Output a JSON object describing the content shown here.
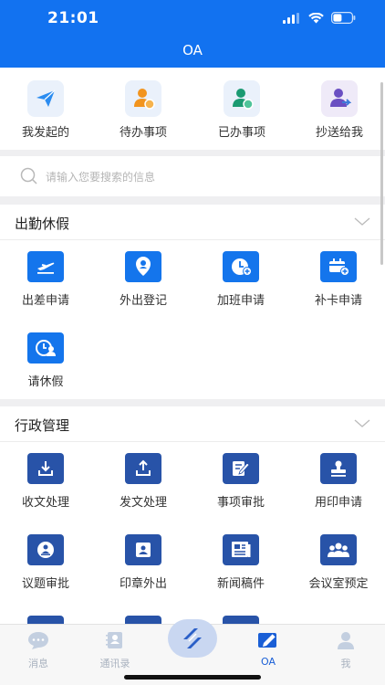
{
  "status": {
    "time": "21:01"
  },
  "header": {
    "title": "OA"
  },
  "quick": [
    {
      "label": "我发起的",
      "icon": "paper-plane-icon"
    },
    {
      "label": "待办事项",
      "icon": "user-pending-icon"
    },
    {
      "label": "已办事项",
      "icon": "user-done-icon"
    },
    {
      "label": "抄送给我",
      "icon": "user-cc-icon"
    }
  ],
  "search": {
    "placeholder": "请输入您要搜索的信息"
  },
  "attendance": {
    "title": "出勤休假",
    "items": [
      {
        "label": "出差申请",
        "icon": "airplane-icon"
      },
      {
        "label": "外出登记",
        "icon": "location-pin-icon"
      },
      {
        "label": "加班申请",
        "icon": "clock-plus-icon"
      },
      {
        "label": "补卡申请",
        "icon": "card-plus-icon"
      },
      {
        "label": "请休假",
        "icon": "clock-person-icon"
      }
    ]
  },
  "admin": {
    "title": "行政管理",
    "items": [
      {
        "label": "收文处理",
        "icon": "download-icon"
      },
      {
        "label": "发文处理",
        "icon": "upload-icon"
      },
      {
        "label": "事项审批",
        "icon": "pen-doc-icon"
      },
      {
        "label": "用印申请",
        "icon": "stamp-icon"
      },
      {
        "label": "议题审批",
        "icon": "topic-icon"
      },
      {
        "label": "印章外出",
        "icon": "seal-out-icon"
      },
      {
        "label": "新闻稿件",
        "icon": "newspaper-icon"
      },
      {
        "label": "会议室预定",
        "icon": "meeting-group-icon"
      }
    ]
  },
  "tabs": [
    {
      "label": "消息",
      "icon": "chat-bubble-icon"
    },
    {
      "label": "通讯录",
      "icon": "contacts-book-icon"
    },
    {
      "label": "",
      "icon": "app-logo-icon"
    },
    {
      "label": "OA",
      "icon": "edit-square-icon"
    },
    {
      "label": "我",
      "icon": "person-icon"
    }
  ],
  "colors": {
    "primary": "#1272f0",
    "icon_blue": "#1475ec",
    "icon_navy": "#2853a8",
    "active_tab": "#1a5fd6"
  }
}
